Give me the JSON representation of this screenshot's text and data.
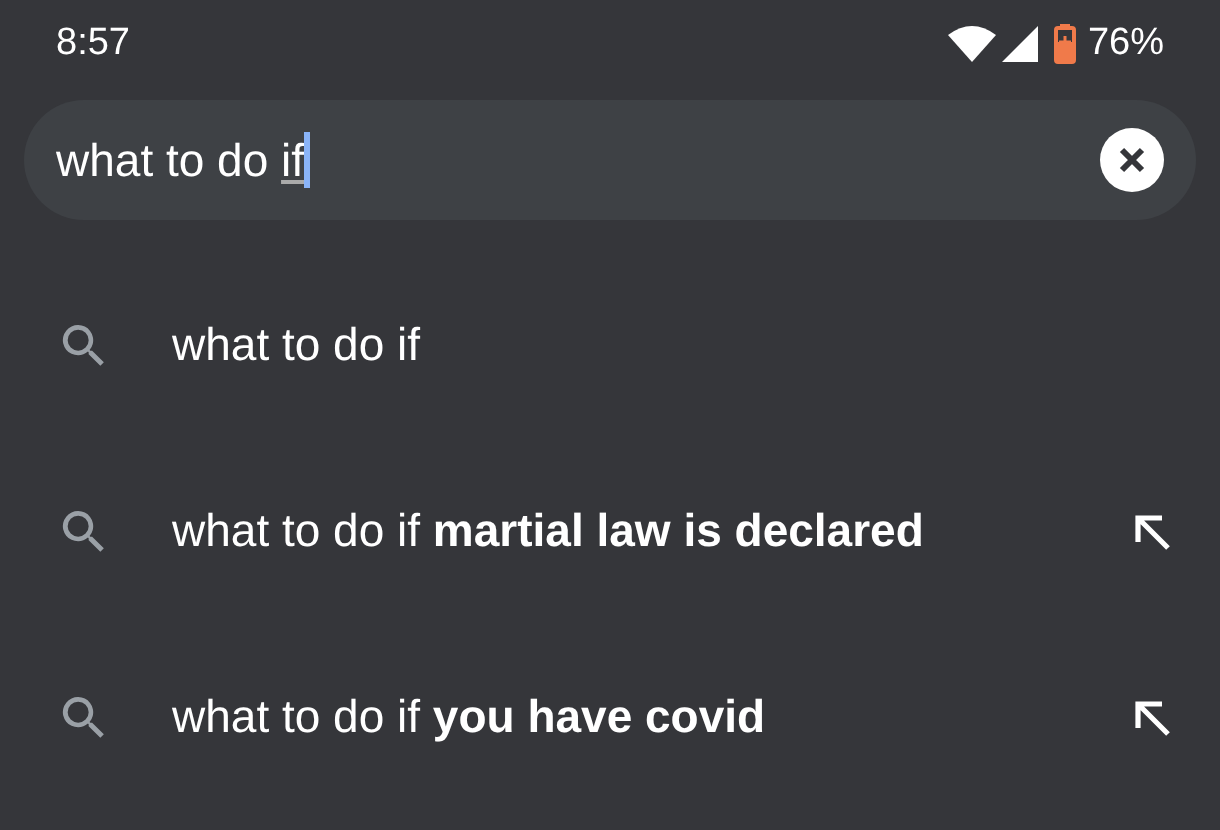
{
  "status_bar": {
    "time": "8:57",
    "battery": "76%"
  },
  "search": {
    "value": "what to do if"
  },
  "suggestions": [
    {
      "text": "what to do if",
      "fill_arrow": false
    },
    {
      "text": "what to do if **martial law is declared**",
      "fill_arrow": true
    },
    {
      "text": "what to do if **you have covid**",
      "fill_arrow": true
    }
  ]
}
